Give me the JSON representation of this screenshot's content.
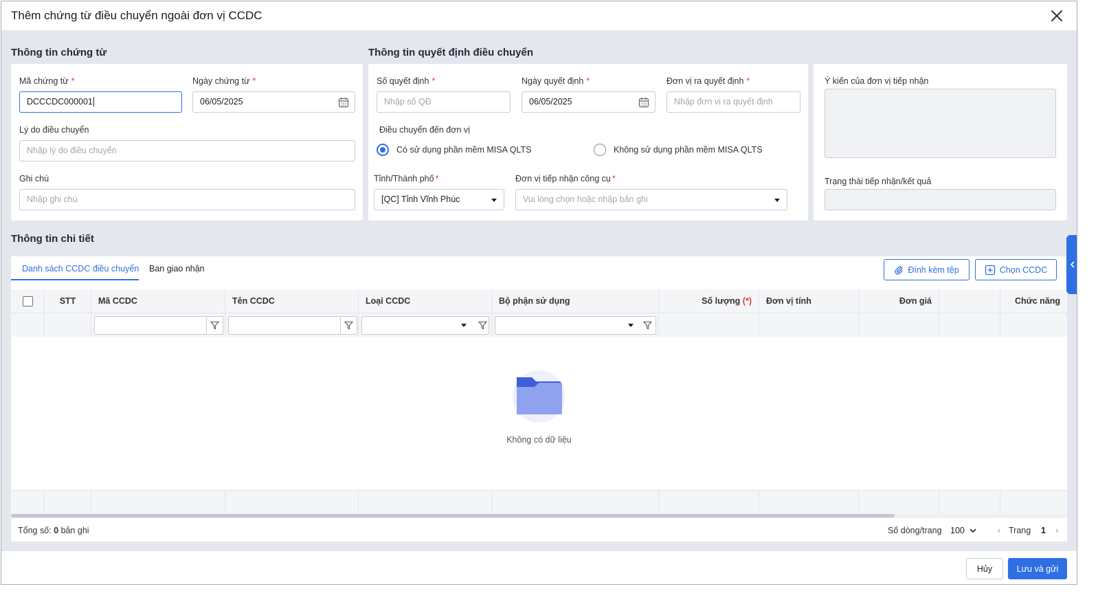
{
  "dialog": {
    "title": "Thêm chứng từ điều chuyển ngoài đơn vị CCDC"
  },
  "voucher_info": {
    "section_title": "Thông tin chứng từ",
    "code_label": "Mã chứng từ",
    "code_value": "DCCCDC000001",
    "date_label": "Ngày chứng từ",
    "date_value": "06/05/2025",
    "reason_label": "Lý do điều chuyển",
    "reason_placeholder": "Nhập lý do điều chuyển",
    "note_label": "Ghi chú",
    "note_placeholder": "Nhập ghi chú"
  },
  "decision_info": {
    "section_title": "Thông tin quyết định điều chuyển",
    "number_label": "Số quyết định",
    "number_placeholder": "Nhập số QĐ",
    "date_label": "Ngày quyết định",
    "date_value": "06/05/2025",
    "issuer_label": "Đơn vị ra quyết định",
    "issuer_placeholder": "Nhập đơn vị ra quyết định",
    "transfer_to_label": "Điều chuyển đến đơn vị",
    "radio_option_1": "Có sử dụng phần mềm MISA QLTS",
    "radio_option_2": "Không sử dụng phần mềm MISA QLTS",
    "selected_option": 1,
    "province_label": "Tỉnh/Thành phố",
    "province_value": "[QC] Tỉnh Vĩnh Phúc",
    "receiver_label": "Đơn vị tiếp nhận công cụ",
    "receiver_placeholder": "Vui lòng chọn hoặc nhập bản ghi"
  },
  "receiver_feedback": {
    "opinion_label": "Ý kiến của đơn vị tiếp nhận",
    "status_label": "Trạng thái tiếp nhận/kết quả"
  },
  "detail": {
    "section_title": "Thông tin chi tiết",
    "tabs": [
      {
        "label": "Danh sách CCDC điều chuyển"
      },
      {
        "label": "Ban giao nhận"
      }
    ],
    "attach_button": "Đính kèm tệp",
    "choose_button": "Chọn CCDC",
    "columns": {
      "stt": "STT",
      "code": "Mã CCDC",
      "name": "Tên CCDC",
      "type": "Loại CCDC",
      "department": "Bộ phận sử dụng",
      "quantity": "Số lượng",
      "quantity_req": "(*)",
      "unit": "Đơn vị tính",
      "price": "Đơn giá",
      "function": "Chức năng"
    },
    "empty_text": "Không có dữ liệu"
  },
  "pager": {
    "total_prefix": "Tổng số:",
    "total_count": "0",
    "total_suffix": "bản ghi",
    "rows_per_page_label": "Số dòng/trang",
    "rows_per_page": "100",
    "page_label": "Trang",
    "page_number": "1"
  },
  "footer": {
    "cancel_button": "Hủy",
    "save_button": "Lưu và gửi"
  },
  "colors": {
    "accent": "#2f6fe4",
    "required": "#e53935",
    "folder": "#5b7be8"
  }
}
